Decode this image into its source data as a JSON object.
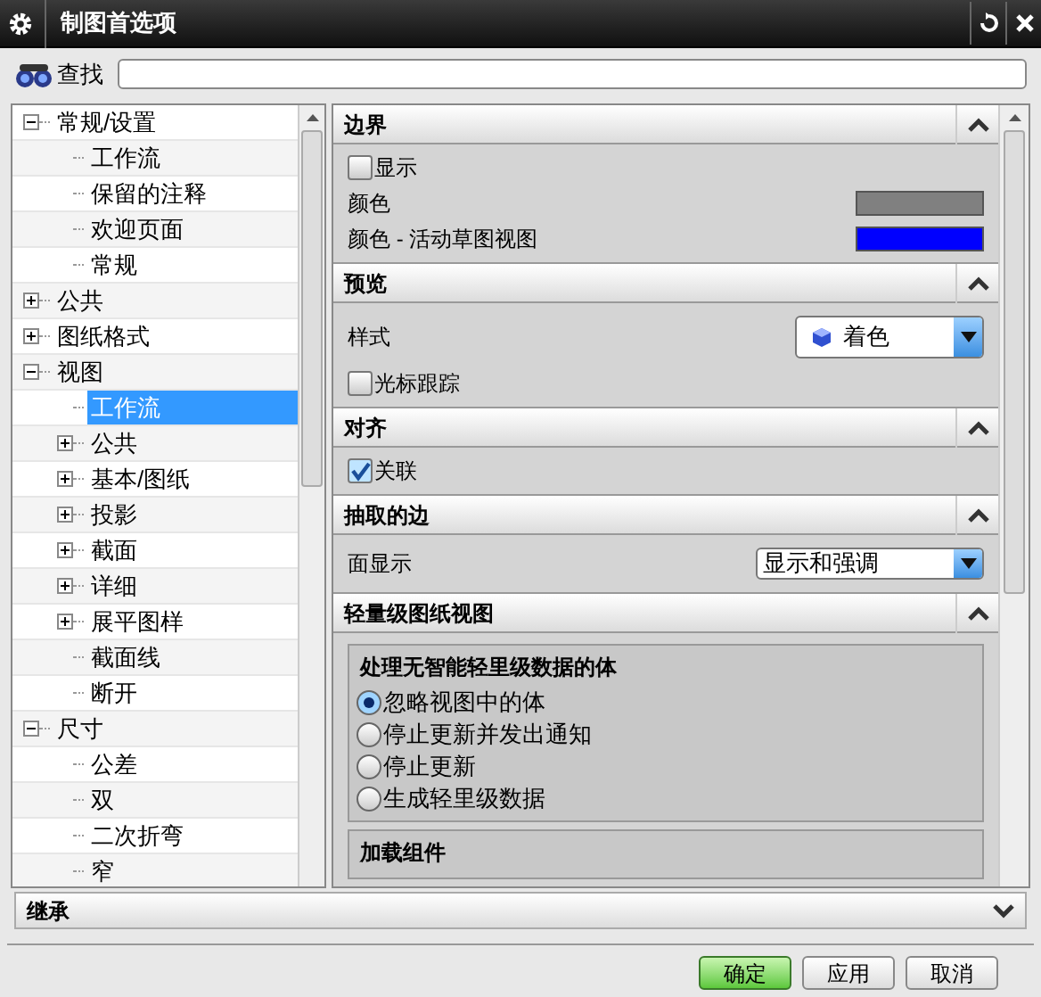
{
  "window": {
    "title": "制图首选项"
  },
  "search": {
    "label": "查找"
  },
  "tree": [
    {
      "label": "常规/设置",
      "expanded": true,
      "children": [
        {
          "label": "工作流",
          "selected": false
        },
        {
          "label": "保留的注释",
          "selected": false
        },
        {
          "label": "欢迎页面",
          "selected": false
        },
        {
          "label": "常规",
          "selected": false
        }
      ],
      "selected": false
    },
    {
      "label": "公共",
      "expanded": false,
      "selected": false
    },
    {
      "label": "图纸格式",
      "expanded": false,
      "selected": false
    },
    {
      "label": "视图",
      "expanded": true,
      "selected": false,
      "children": [
        {
          "label": "工作流",
          "selected": true
        },
        {
          "label": "公共",
          "expanded": false,
          "selected": false
        },
        {
          "label": "基本/图纸",
          "expanded": false,
          "selected": false
        },
        {
          "label": "投影",
          "expanded": false,
          "selected": false
        },
        {
          "label": "截面",
          "expanded": false,
          "selected": false
        },
        {
          "label": "详细",
          "expanded": false,
          "selected": false
        },
        {
          "label": "展平图样",
          "expanded": false,
          "selected": false
        },
        {
          "label": "截面线",
          "selected": false
        },
        {
          "label": "断开",
          "selected": false
        }
      ]
    },
    {
      "label": "尺寸",
      "expanded": true,
      "selected": false,
      "children": [
        {
          "label": "公差",
          "selected": false
        },
        {
          "label": "双",
          "selected": false
        },
        {
          "label": "二次折弯",
          "selected": false
        },
        {
          "label": "窄",
          "selected": false
        }
      ]
    }
  ],
  "sections": [
    {
      "title": "边界",
      "expanded": true,
      "rows": [
        {
          "kind": "checkbox",
          "label": "显示",
          "checked": false
        },
        {
          "kind": "color",
          "label": "颜色",
          "color": "#808080"
        },
        {
          "kind": "color",
          "label": "颜色 - 活动草图视图",
          "color": "#0000ff"
        }
      ]
    },
    {
      "title": "预览",
      "expanded": true,
      "rows": [
        {
          "kind": "dropdown",
          "label": "样式",
          "value": "着色",
          "icon": true
        },
        {
          "kind": "checkbox",
          "label": "光标跟踪",
          "checked": false
        }
      ]
    },
    {
      "title": "对齐",
      "expanded": true,
      "rows": [
        {
          "kind": "checkbox",
          "label": "关联",
          "checked": true
        }
      ]
    },
    {
      "title": "抽取的边",
      "expanded": true,
      "rows": [
        {
          "kind": "dropdown",
          "label": "面显示",
          "value": "显示和强调"
        }
      ]
    },
    {
      "title": "轻量级图纸视图",
      "expanded": true,
      "groups": [
        {
          "title": "处理无智能轻里级数据的体",
          "options": [
            {
              "label": "忽略视图中的体",
              "selected": true
            },
            {
              "label": "停止更新并发出通知",
              "selected": false
            },
            {
              "label": "停止更新",
              "selected": false
            },
            {
              "label": "生成轻里级数据",
              "selected": false
            }
          ]
        },
        {
          "title": "加载组件"
        }
      ]
    }
  ],
  "inherit": {
    "title": "继承",
    "expanded": false
  },
  "buttons": [
    {
      "label": "确定",
      "kind": "default"
    },
    {
      "label": "应用",
      "kind": "normal"
    },
    {
      "label": "取消",
      "kind": "normal"
    }
  ]
}
